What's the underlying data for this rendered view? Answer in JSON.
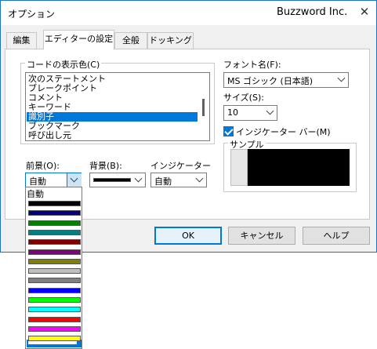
{
  "window": {
    "title_left": "オプション",
    "title_right": "Buzzword Inc.",
    "close_icon": "close-icon"
  },
  "tabs": [
    {
      "label": "編集",
      "active": false
    },
    {
      "label": "エディターの設定",
      "active": true
    },
    {
      "label": "全般",
      "active": false
    },
    {
      "label": "ドッキング",
      "active": false
    }
  ],
  "code_display": {
    "group_label": "コードの表示色(C)",
    "items": [
      "次のステートメント",
      "ブレークポイント",
      "コメント",
      "キーワード",
      "識別子",
      "ブックマーク",
      "呼び出し元"
    ],
    "selected_index": 4
  },
  "foreground": {
    "label": "前景(O):",
    "value": "自動",
    "dropdown_first": "自動",
    "swatches": [
      "#000000",
      "#000080",
      "#008000",
      "#008080",
      "#800000",
      "#800080",
      "#808000",
      "#c0c0c0",
      "#808080",
      "#0000ff",
      "#00ff00",
      "#00ffff",
      "#ff0000",
      "#ff00ff",
      "#ffff00",
      "#ffffff"
    ]
  },
  "background": {
    "label": "背景(B):",
    "swatch": "#000000"
  },
  "indicator": {
    "label": "インジケーター",
    "value": "自動"
  },
  "font": {
    "label": "フォント名(F):",
    "value": "MS ゴシック (日本語)"
  },
  "size": {
    "label": "サイズ(S):",
    "value": "10"
  },
  "indicator_bar": {
    "label": "インジケーター バー(M)",
    "checked": true
  },
  "sample": {
    "label": "サンプル"
  },
  "buttons": {
    "ok": "OK",
    "cancel": "キャンセル",
    "help": "ヘルプ"
  },
  "colors": {
    "accent": "#0078d7",
    "selection": "#0078d7"
  }
}
